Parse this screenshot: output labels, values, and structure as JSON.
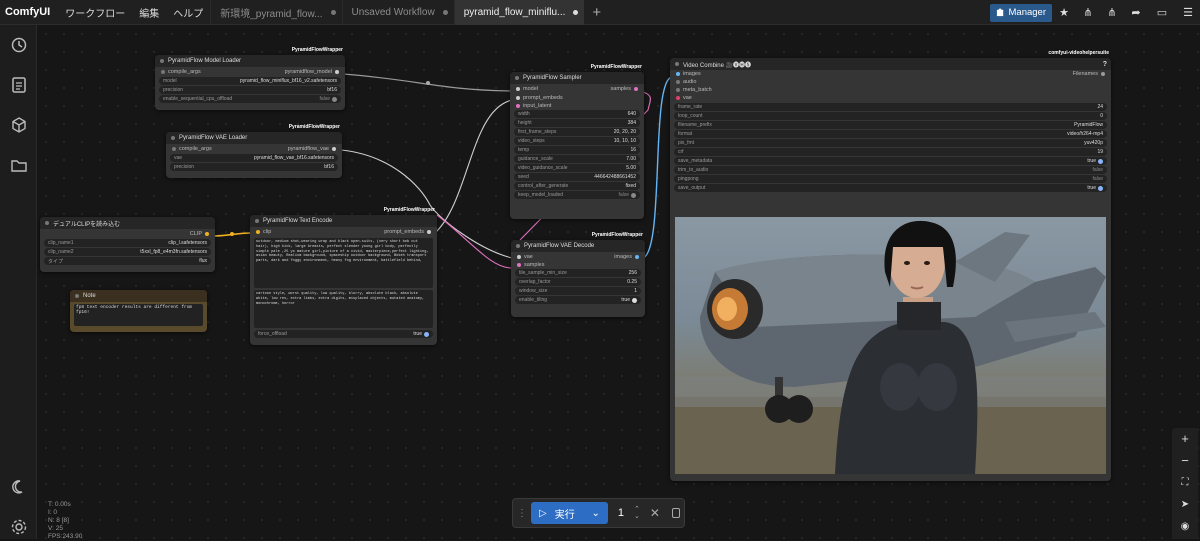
{
  "app": {
    "name": "ComfyUI"
  },
  "menu": [
    "ワークフロー",
    "編集",
    "ヘルプ"
  ],
  "tabs": [
    {
      "label": "新環境_pyramid_flow...",
      "active": false
    },
    {
      "label": "Unsaved Workflow",
      "active": false
    },
    {
      "label": "pyramid_flow_miniflu...",
      "active": true
    }
  ],
  "toolbar": {
    "manager_label": "Manager"
  },
  "nodes": {
    "model_loader": {
      "badge": "PyramidFlowWrapper",
      "title": "PyramidFlow Model Loader",
      "in": "compile_args",
      "out": "pyramidflow_model",
      "w": [
        {
          "l": "model",
          "v": "pyramid_flow_miniflux_bf16_v2.safetensors"
        },
        {
          "l": "precision",
          "v": "bf16"
        },
        {
          "l": "enable_sequential_cpu_offload",
          "v": "false"
        }
      ]
    },
    "vae_loader": {
      "badge": "PyramidFlowWrapper",
      "title": "PyramidFlow VAE Loader",
      "in": "compile_args",
      "out": "pyramidflow_vae",
      "w": [
        {
          "l": "vae",
          "v": "pyramid_flow_vae_bf16.safetensors"
        },
        {
          "l": "precision",
          "v": "bf16"
        }
      ]
    },
    "clip_loader": {
      "title": "デュアルCLIPを読み込む",
      "out": "CLIP",
      "w": [
        {
          "l": "clip_name1",
          "v": "clip_l.safetensors"
        },
        {
          "l": "clip_name2",
          "v": "t5xxl_fp8_e4m3fn.safetensors"
        },
        {
          "l": "タイプ",
          "v": "flux"
        }
      ]
    },
    "note": {
      "title": "Note",
      "text": "fp8 text encoder results are different from fp16!"
    },
    "text_encode": {
      "badge": "PyramidFlowWrapper",
      "title": "PyramidFlow Text Encode",
      "in": "clip",
      "out": "prompt_embeds",
      "positive": "outdoor, medium shot,wearing wrap and black open-suits, (very short bob cut hair), high kick, large breasts, perfect slender young girl body, perfectly simple pale ,25 yo mature girl,picture of a vivid, masterpiece,perfect lighting, asian beauty, Realism background, spaceship outdoor background, Bokeh transport parts, dark and foggy environment, heavy fog environment, battlefield behind,",
      "negative": "cartoon style, worst quality, low quality, blurry, absolute black, absolute white, low res, extra limbs, extra digits, misplaced objects, mutated anatomy, monochrome, horror",
      "force_label": "force_offload",
      "force_value": "true"
    },
    "sampler": {
      "badge": "PyramidFlowWrapper",
      "title": "PyramidFlow Sampler",
      "inputs": [
        "model",
        "prompt_embeds",
        "input_latent"
      ],
      "out": "samples",
      "w": [
        {
          "l": "width",
          "v": "640"
        },
        {
          "l": "height",
          "v": "384"
        },
        {
          "l": "first_frame_steps",
          "v": "20, 20, 20"
        },
        {
          "l": "video_steps",
          "v": "10, 10, 10"
        },
        {
          "l": "temp",
          "v": "16"
        },
        {
          "l": "guidance_scale",
          "v": "7.00"
        },
        {
          "l": "video_guidance_scale",
          "v": "5.00"
        },
        {
          "l": "seed",
          "v": "446642488661452"
        },
        {
          "l": "control_after_generate",
          "v": "fixed"
        },
        {
          "l": "keep_model_loaded",
          "v": "false"
        }
      ]
    },
    "vae_decode": {
      "badge": "PyramidFlowWrapper",
      "title": "PyramidFlow VAE Decode",
      "inputs": [
        "vae",
        "samples"
      ],
      "out": "images",
      "w": [
        {
          "l": "tile_sample_min_size",
          "v": "256"
        },
        {
          "l": "overlap_factor",
          "v": "0.25"
        },
        {
          "l": "window_size",
          "v": "1"
        },
        {
          "l": "enable_tiling",
          "v": "true"
        }
      ]
    },
    "video_combine": {
      "badge": "comfyui-videohelpersuite",
      "title": "Video Combine 🎥🅥🅗🅢",
      "inputs": [
        "images",
        "audio",
        "meta_batch",
        "vae"
      ],
      "out": "Filenames",
      "w": [
        {
          "l": "frame_rate",
          "v": "24"
        },
        {
          "l": "loop_count",
          "v": "0"
        },
        {
          "l": "filename_prefix",
          "v": "PyramidFlow"
        },
        {
          "l": "format",
          "v": "video/h264-mp4"
        },
        {
          "l": "pix_fmt",
          "v": "yuv420p"
        },
        {
          "l": "crf",
          "v": "19"
        },
        {
          "l": "save_metadata",
          "v": "true"
        },
        {
          "l": "trim_to_audio",
          "v": "false"
        },
        {
          "l": "pingpong",
          "v": "false"
        },
        {
          "l": "save_output",
          "v": "true"
        }
      ]
    }
  },
  "run": {
    "label": "実行",
    "count": "1"
  },
  "stats": [
    "T: 0.00s",
    "I: 0",
    "N: 8 [8]",
    "V: 25",
    "FPS:243.90"
  ]
}
